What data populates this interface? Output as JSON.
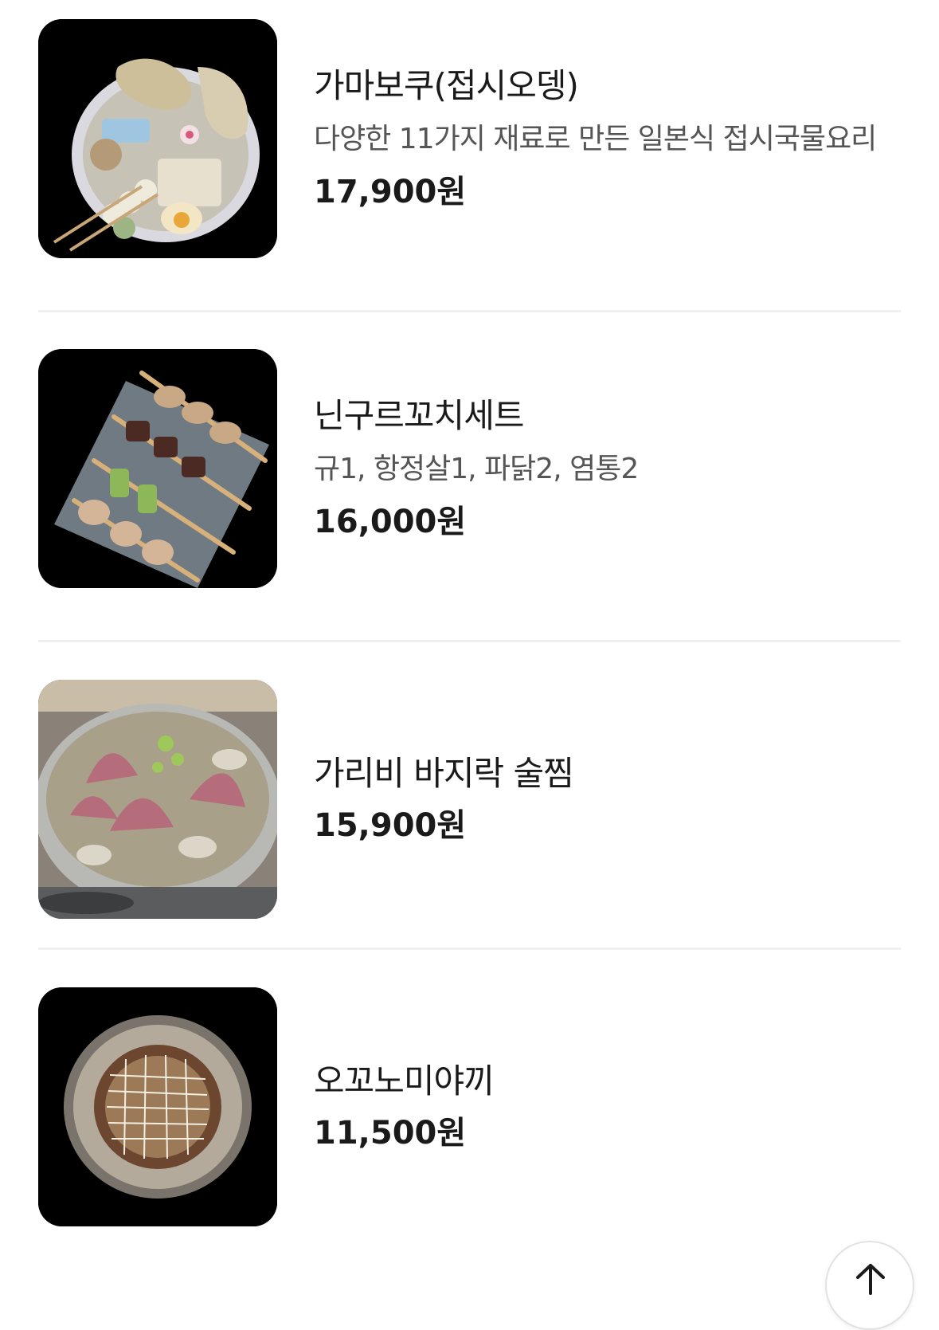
{
  "menu": {
    "items": [
      {
        "name": "가마보쿠(접시오뎅)",
        "description": "다양한 11가지 재료로 만든 일본식 접시국물요리",
        "price": "17,900원",
        "image": "oden-plate"
      },
      {
        "name": "닌구르꼬치세트",
        "description": "규1, 항정살1, 파닭2, 염통2",
        "price": "16,000원",
        "image": "skewer-set"
      },
      {
        "name": "가리비 바지락 술찜",
        "price": "15,900원",
        "image": "scallop-clam-pot"
      },
      {
        "name": "오꼬노미야끼",
        "price": "11,500원",
        "image": "okonomiyaki"
      }
    ]
  },
  "scroll_top": {
    "icon": "arrow-up-icon"
  },
  "colors": {
    "text_primary": "#1a1a1a",
    "text_secondary": "#555555",
    "divider": "#f0f0f0",
    "thumb_background": "#000000"
  }
}
